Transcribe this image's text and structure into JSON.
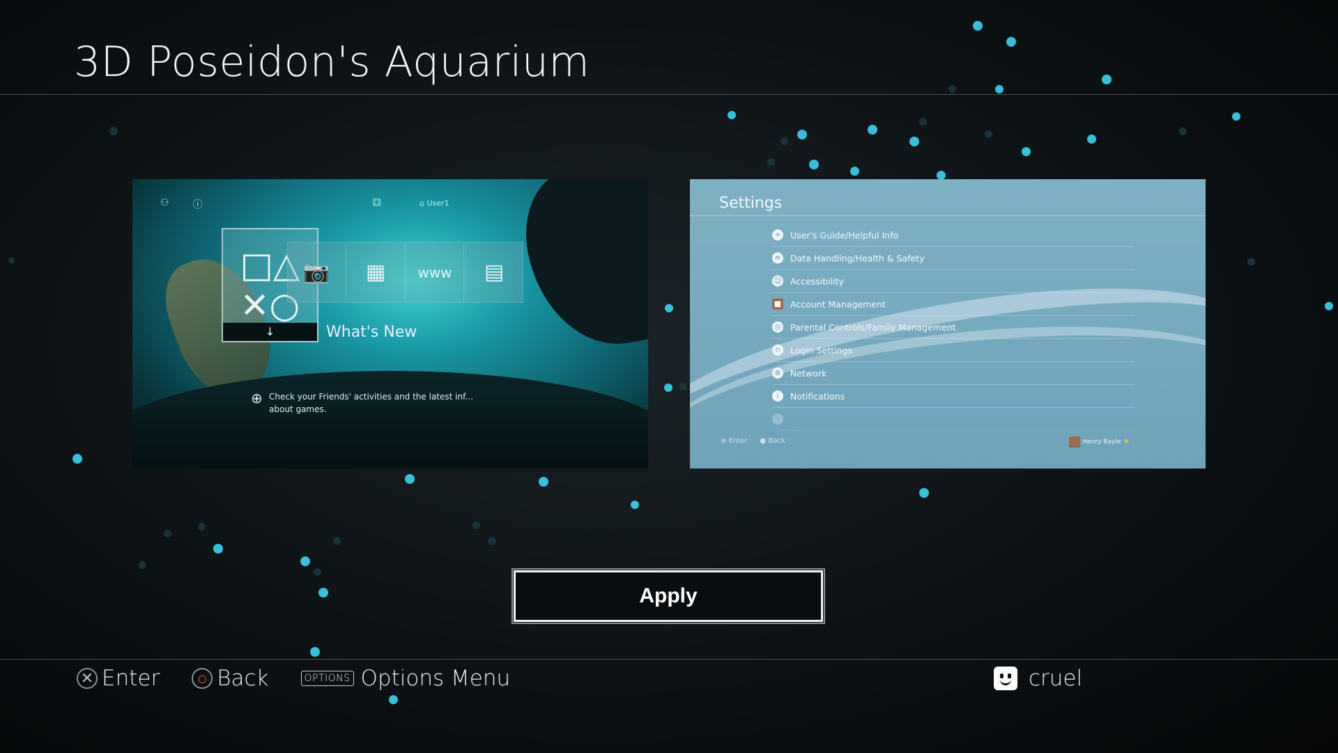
{
  "page": {
    "title": "3D Poseidon's Aquarium"
  },
  "home_preview": {
    "user_label": "User1",
    "tile_main_arrow": "↓",
    "whats_new": "What's New",
    "hint": "Check your Friends' activities and the latest inf... about games.",
    "tiles": [
      "camera-icon",
      "library-icon",
      "www-icon",
      "tv-icon"
    ]
  },
  "settings_preview": {
    "title": "Settings",
    "items": [
      {
        "label": "User's Guide/Helpful Info",
        "icon": "help-icon"
      },
      {
        "label": "Data Handling/Health & Safety",
        "icon": "data-icon"
      },
      {
        "label": "Accessibility",
        "icon": "accessibility-icon"
      },
      {
        "label": "Account Management",
        "icon": "account-icon"
      },
      {
        "label": "Parental Controls/Family Management",
        "icon": "parental-icon"
      },
      {
        "label": "Login Settings",
        "icon": "login-icon"
      },
      {
        "label": "Network",
        "icon": "network-icon"
      },
      {
        "label": "Notifications",
        "icon": "notification-icon"
      }
    ],
    "footer_enter": "Enter",
    "footer_back": "Back",
    "user": "Henry Bayle"
  },
  "apply_button": {
    "label": "Apply"
  },
  "footer": {
    "enter": "Enter",
    "back": "Back",
    "options_key": "OPTIONS",
    "options_menu": "Options Menu",
    "user": "cruel"
  },
  "colors": {
    "background": "#0d1215",
    "accent_cyan": "#38c3df",
    "settings_bg": "#6fa3ba"
  }
}
